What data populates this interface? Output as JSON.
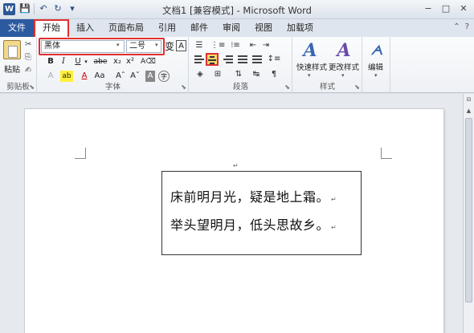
{
  "window": {
    "title": "文档1 [兼容模式] - Microsoft Word",
    "app_icon": "W",
    "qat": [
      "save-icon",
      "undo-icon",
      "redo-icon"
    ],
    "controls": [
      "−",
      "□",
      "✕"
    ]
  },
  "tabs": {
    "file": "文件",
    "items": [
      "开始",
      "插入",
      "页面布局",
      "引用",
      "邮件",
      "审阅",
      "视图",
      "加载项"
    ],
    "active": "开始",
    "right_icons": [
      "⌃",
      "?"
    ]
  },
  "ribbon": {
    "clipboard": {
      "paste": "粘贴",
      "label": "剪贴板",
      "cut": "✂",
      "copy": "⎘",
      "format_painter": "✍"
    },
    "font": {
      "name": "黑体",
      "size": "二号",
      "label": "字体",
      "row1_extra": [
        "Aˆ",
        "Aˇ",
        "Aa",
        "变",
        "A"
      ],
      "row2": [
        "B",
        "I",
        "U",
        "abe",
        "x₂",
        "x²"
      ],
      "row3": [
        "A",
        "ab",
        "A",
        "Aa",
        "Aˆ",
        "Aˇ",
        "A",
        "字"
      ]
    },
    "paragraph": {
      "label": "段落"
    },
    "styles": {
      "quick": "快速样式",
      "change": "更改样式",
      "label": "样式"
    },
    "editing": {
      "label": "编辑"
    }
  },
  "document": {
    "lines": [
      "床前明月光，疑是地上霜。",
      "举头望明月，低头思故乡。"
    ],
    "para_mark": "↵"
  },
  "colors": {
    "accent": "#2c5aa0",
    "highlight_border": "#e03030",
    "active_align": "#fbd56a"
  }
}
